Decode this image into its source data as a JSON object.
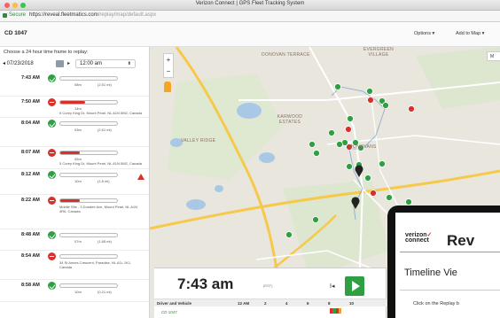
{
  "window": {
    "title": "Verizon Connect | GPS Fleet Tracking System"
  },
  "address_bar": {
    "secure_label": "Secure",
    "url_host": "https://reveal.fleetmatics.com",
    "url_path": "/replay/map/default.aspx"
  },
  "header": {
    "vehicle": "CD 1047",
    "options_label": "Options ▾",
    "add_to_map_label": "Add to Map ▾"
  },
  "left_panel": {
    "choose_label": "Choose a 24 hour time frame to replay:",
    "date": "◂ 07/23/2018",
    "next_label": "▸",
    "time_select": "12:00 am",
    "trips": [
      {
        "time": "7:43 AM",
        "status": "green",
        "d1": "08m",
        "d2": "(2.51 mi)",
        "addr": ""
      },
      {
        "time": "7:50 AM",
        "status": "red",
        "d1": "14m",
        "d2": "",
        "addr": "5 Corey King Dr, Mount Pearl, NL A1N 5M2, Canada"
      },
      {
        "time": "8:04 AM",
        "status": "green",
        "d1": "03m",
        "d2": "(2.61 mi)",
        "addr": ""
      },
      {
        "time": "8:07 AM",
        "status": "red",
        "d1": "05m",
        "d2": "",
        "addr": "5 Corey King Dr, Mount Pearl, NL A1N 5M2, Canada"
      },
      {
        "time": "8:12 AM",
        "status": "green",
        "d1": "10m",
        "d2": "(1.8 mi)",
        "addr": ""
      },
      {
        "time": "8:22 AM",
        "status": "red",
        "d1": "",
        "d2": "",
        "addr": "Mobile Site - 3 Dundee Ave, Mount Pearl, NL A1N 4R6, Canada"
      },
      {
        "time": "8:48 AM",
        "status": "green",
        "d1": "07m",
        "d2": "(1.65 mi)",
        "addr": ""
      },
      {
        "time": "8:54 AM",
        "status": "red",
        "d1": "",
        "d2": "",
        "addr": "34 St Annes Crescent, Paradise, NL A1L 1K1, Canada"
      },
      {
        "time": "8:58 AM",
        "status": "green",
        "d1": "10m",
        "d2": "(0.21 mi)",
        "addr": ""
      }
    ]
  },
  "map": {
    "labels": [
      "DONOVAN TERRACE",
      "EVERGREEN VILLAGE",
      "KARWOOD ESTATES",
      "VALLEY RIDGE",
      "DONOVANS"
    ],
    "zoom_in": "+",
    "zoom_out": "−",
    "map_type_label": "M"
  },
  "timeline": {
    "time": "7:43 am",
    "tz": "(EST)",
    "skip_label": "I◂",
    "driver_header": "Driver and Vehicle",
    "ticks": [
      "12 AM",
      "2",
      "4",
      "6",
      "8",
      "10"
    ],
    "vehicle": "CD 1047"
  },
  "overlay": {
    "logo_line1": "verizon",
    "logo_slash": "✓",
    "logo_line2": "connect",
    "title": "Rev",
    "subtitle": "Timeline Vie",
    "hint": "Click on the Replay b"
  }
}
